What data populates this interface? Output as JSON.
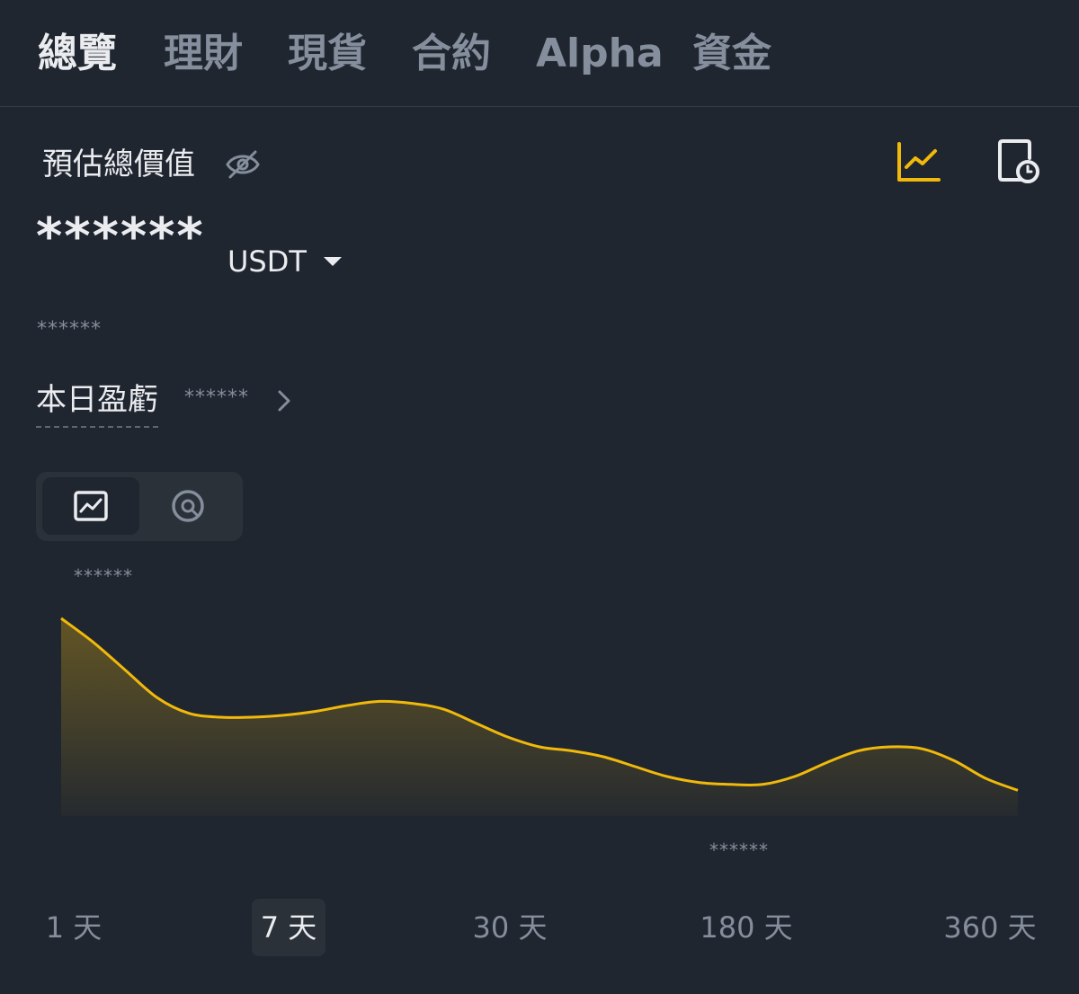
{
  "tabs": [
    {
      "label": "總覽",
      "active": true
    },
    {
      "label": "理財",
      "active": false
    },
    {
      "label": "現貨",
      "active": false
    },
    {
      "label": "合約",
      "active": false
    },
    {
      "label": "Alpha",
      "active": false
    },
    {
      "label": "資金",
      "active": false
    }
  ],
  "summary": {
    "label": "預估總價值",
    "balance": "******",
    "currency": "USDT",
    "secondary_value": "******",
    "pnl_label": "本日盈虧",
    "pnl_value": "******"
  },
  "icons": {
    "hide_balance": "eye-slash-icon",
    "chart_view": "line-chart-icon",
    "history": "document-clock-icon",
    "pnl_detail": "chevron-right-icon",
    "line_mode": "line-chart-icon",
    "pie_mode": "pie-chart-icon"
  },
  "chart": {
    "max_label": "******",
    "min_label": "******",
    "line_color": "#f0b90b",
    "relative_values": [
      1.0,
      0.88,
      0.74,
      0.6,
      0.52,
      0.5,
      0.5,
      0.51,
      0.53,
      0.56,
      0.58,
      0.57,
      0.54,
      0.47,
      0.4,
      0.35,
      0.33,
      0.3,
      0.25,
      0.2,
      0.17,
      0.16,
      0.16,
      0.2,
      0.27,
      0.33,
      0.35,
      0.34,
      0.28,
      0.19,
      0.13
    ]
  },
  "periods": [
    {
      "label": "1 天",
      "active": false
    },
    {
      "label": "7 天",
      "active": true
    },
    {
      "label": "30 天",
      "active": false
    },
    {
      "label": "180 天",
      "active": false
    },
    {
      "label": "360 天",
      "active": false
    }
  ],
  "colors": {
    "background": "#202630",
    "accent": "#f0b90b",
    "text_primary": "#eaecef",
    "text_secondary": "#848e9c"
  }
}
